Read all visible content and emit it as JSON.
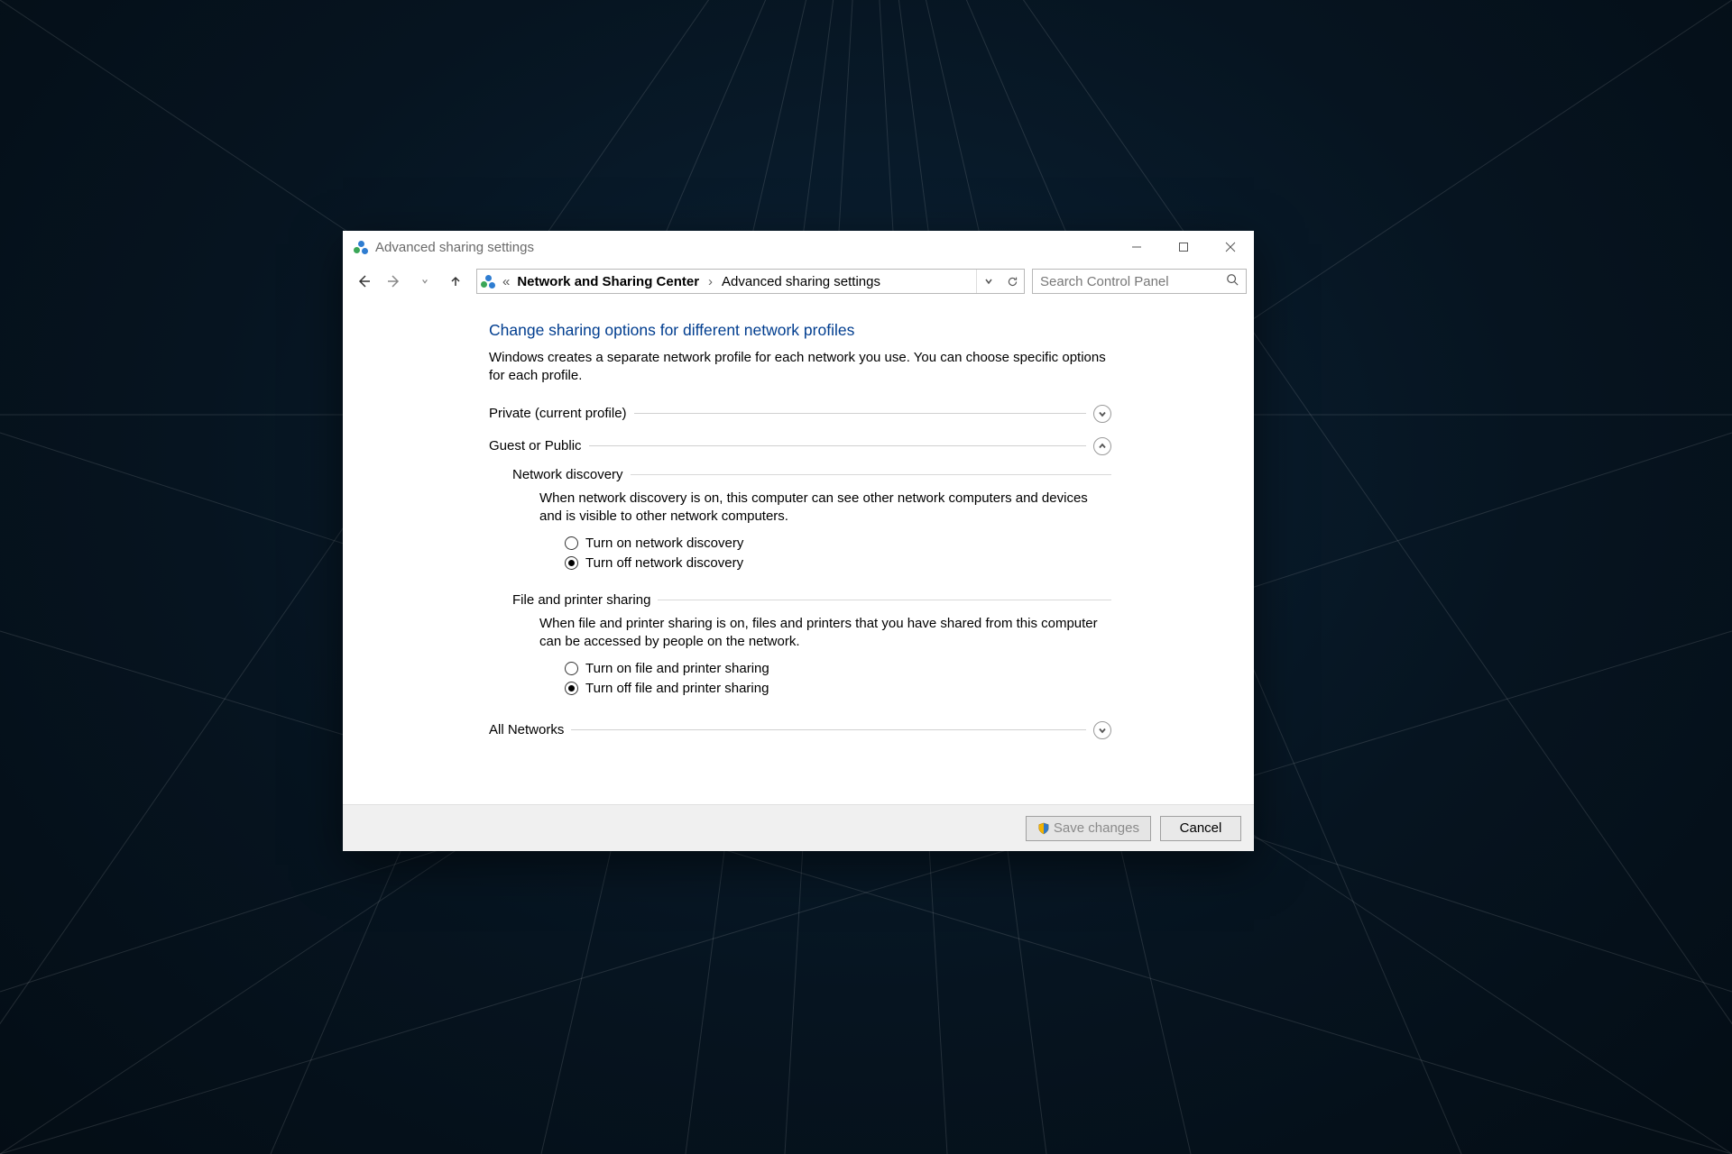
{
  "window": {
    "title": "Advanced sharing settings"
  },
  "breadcrumb": {
    "root_glyph": "«",
    "item1": "Network and Sharing Center",
    "item2": "Advanced sharing settings"
  },
  "search": {
    "placeholder": "Search Control Panel"
  },
  "page": {
    "title": "Change sharing options for different network profiles",
    "description": "Windows creates a separate network profile for each network you use. You can choose specific options for each profile."
  },
  "profiles": {
    "private": {
      "label": "Private (current profile)"
    },
    "guest": {
      "label": "Guest or Public"
    },
    "all": {
      "label": "All Networks"
    }
  },
  "sections": {
    "discovery": {
      "label": "Network discovery",
      "desc": "When network discovery is on, this computer can see other network computers and devices and is visible to other network computers.",
      "on": "Turn on network discovery",
      "off": "Turn off network discovery"
    },
    "fps": {
      "label": "File and printer sharing",
      "desc": "When file and printer sharing is on, files and printers that you have shared from this computer can be accessed by people on the network.",
      "on": "Turn on file and printer sharing",
      "off": "Turn off file and printer sharing"
    }
  },
  "footer": {
    "save": "Save changes",
    "cancel": "Cancel"
  }
}
